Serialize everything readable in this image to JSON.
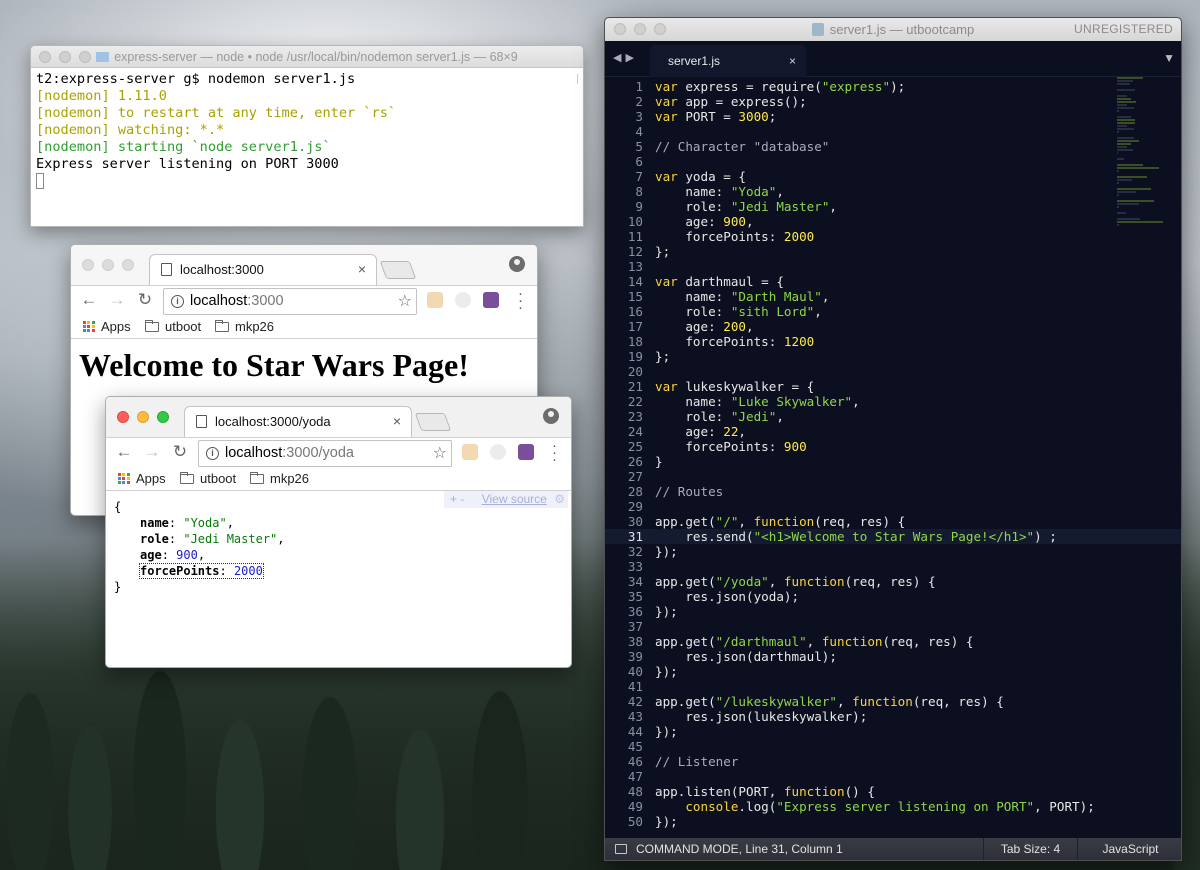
{
  "terminal": {
    "title": "express-server — node • node /usr/local/bin/nodemon server1.js — 68×9",
    "lines": [
      {
        "text": "t2:express-server g$ nodemon server1.js",
        "style": "plain"
      },
      {
        "text": "[nodemon] 1.11.0",
        "style": "yellow"
      },
      {
        "text": "[nodemon] to restart at any time, enter `rs`",
        "style": "yellow"
      },
      {
        "text": "[nodemon] watching: *.*",
        "style": "yellow"
      },
      {
        "text": "[nodemon] starting `node server1.js`",
        "style": "green"
      },
      {
        "text": "Express server listening on PORT 3000",
        "style": "plain"
      }
    ]
  },
  "browser_back": {
    "tab_title": "localhost:3000",
    "url_host": "localhost",
    "url_path": ":3000",
    "bookmarks": [
      "Apps",
      "utboot",
      "mkp26"
    ],
    "heading": "Welcome to Star Wars Page!"
  },
  "browser_front": {
    "tab_title": "localhost:3000/yoda",
    "url_host": "localhost",
    "url_path": ":3000/yoda",
    "bookmarks": [
      "Apps",
      "utboot",
      "mkp26"
    ],
    "view_source_controls": "+ -",
    "view_source": "View source",
    "json": {
      "open": "{",
      "close": "}",
      "entries": [
        {
          "key": "name",
          "value": "\"Yoda\"",
          "type": "string"
        },
        {
          "key": "role",
          "value": "\"Jedi Master\"",
          "type": "string"
        },
        {
          "key": "age",
          "value": "900",
          "type": "number"
        },
        {
          "key": "forcePoints",
          "value": "2000",
          "type": "number"
        }
      ]
    }
  },
  "editor": {
    "title": "server1.js — utbootcamp",
    "unregistered": "UNREGISTERED",
    "tab": "server1.js",
    "current_line": 31,
    "status": {
      "mode": "COMMAND MODE, Line 31, Column 1",
      "tab_size": "Tab Size: 4",
      "syntax": "JavaScript"
    },
    "code": [
      [
        [
          "kw",
          "var"
        ],
        [
          "p",
          " express = require("
        ],
        [
          "str",
          "\"express\""
        ],
        [
          "p",
          ");"
        ]
      ],
      [
        [
          "kw",
          "var"
        ],
        [
          "p",
          " app = express();"
        ]
      ],
      [
        [
          "kw",
          "var"
        ],
        [
          "p",
          " PORT = "
        ],
        [
          "num",
          "3000"
        ],
        [
          "p",
          ";"
        ]
      ],
      [],
      [
        [
          "com",
          "// Character \"database\""
        ]
      ],
      [],
      [
        [
          "kw",
          "var"
        ],
        [
          "p",
          " yoda = {"
        ]
      ],
      [
        [
          "p",
          "    name: "
        ],
        [
          "str",
          "\"Yoda\""
        ],
        [
          "p",
          ","
        ]
      ],
      [
        [
          "p",
          "    role: "
        ],
        [
          "str",
          "\"Jedi Master\""
        ],
        [
          "p",
          ","
        ]
      ],
      [
        [
          "p",
          "    age: "
        ],
        [
          "num",
          "900"
        ],
        [
          "p",
          ","
        ]
      ],
      [
        [
          "p",
          "    forcePoints: "
        ],
        [
          "num",
          "2000"
        ]
      ],
      [
        [
          "p",
          "};"
        ]
      ],
      [],
      [
        [
          "kw",
          "var"
        ],
        [
          "p",
          " darthmaul = {"
        ]
      ],
      [
        [
          "p",
          "    name: "
        ],
        [
          "str",
          "\"Darth Maul\""
        ],
        [
          "p",
          ","
        ]
      ],
      [
        [
          "p",
          "    role: "
        ],
        [
          "str",
          "\"sith Lord\""
        ],
        [
          "p",
          ","
        ]
      ],
      [
        [
          "p",
          "    age: "
        ],
        [
          "num",
          "200"
        ],
        [
          "p",
          ","
        ]
      ],
      [
        [
          "p",
          "    forcePoints: "
        ],
        [
          "num",
          "1200"
        ]
      ],
      [
        [
          "p",
          "};"
        ]
      ],
      [],
      [
        [
          "kw",
          "var"
        ],
        [
          "p",
          " lukeskywalker = {"
        ]
      ],
      [
        [
          "p",
          "    name: "
        ],
        [
          "str",
          "\"Luke Skywalker\""
        ],
        [
          "p",
          ","
        ]
      ],
      [
        [
          "p",
          "    role: "
        ],
        [
          "str",
          "\"Jedi\""
        ],
        [
          "p",
          ","
        ]
      ],
      [
        [
          "p",
          "    age: "
        ],
        [
          "num",
          "22"
        ],
        [
          "p",
          ","
        ]
      ],
      [
        [
          "p",
          "    forcePoints: "
        ],
        [
          "num",
          "900"
        ]
      ],
      [
        [
          "p",
          "}"
        ]
      ],
      [],
      [
        [
          "com",
          "// Routes"
        ]
      ],
      [],
      [
        [
          "p",
          "app.get("
        ],
        [
          "str",
          "\"/\""
        ],
        [
          "p",
          ", "
        ],
        [
          "kw",
          "function"
        ],
        [
          "p",
          "(req, res) {"
        ]
      ],
      [
        [
          "p",
          "    res.send("
        ],
        [
          "str",
          "\"<h1>Welcome to Star Wars Page!</h1>\""
        ],
        [
          "p",
          ") ;"
        ]
      ],
      [
        [
          "p",
          "});"
        ]
      ],
      [],
      [
        [
          "p",
          "app.get("
        ],
        [
          "str",
          "\"/yoda\""
        ],
        [
          "p",
          ", "
        ],
        [
          "kw",
          "function"
        ],
        [
          "p",
          "(req, res) {"
        ]
      ],
      [
        [
          "p",
          "    res.json(yoda);"
        ]
      ],
      [
        [
          "p",
          "});"
        ]
      ],
      [],
      [
        [
          "p",
          "app.get("
        ],
        [
          "str",
          "\"/darthmaul\""
        ],
        [
          "p",
          ", "
        ],
        [
          "kw",
          "function"
        ],
        [
          "p",
          "(req, res) {"
        ]
      ],
      [
        [
          "p",
          "    res.json(darthmaul);"
        ]
      ],
      [
        [
          "p",
          "});"
        ]
      ],
      [],
      [
        [
          "p",
          "app.get("
        ],
        [
          "str",
          "\"/lukeskywalker\""
        ],
        [
          "p",
          ", "
        ],
        [
          "kw",
          "function"
        ],
        [
          "p",
          "(req, res) {"
        ]
      ],
      [
        [
          "p",
          "    res.json(lukeskywalker);"
        ]
      ],
      [
        [
          "p",
          "});"
        ]
      ],
      [],
      [
        [
          "com",
          "// Listener"
        ]
      ],
      [],
      [
        [
          "p",
          "app.listen(PORT, "
        ],
        [
          "kw",
          "function"
        ],
        [
          "p",
          "() {"
        ]
      ],
      [
        [
          "p",
          "    "
        ],
        [
          "kw",
          "console"
        ],
        [
          "p",
          ".log("
        ],
        [
          "str",
          "\"Express server listening on PORT\""
        ],
        [
          "p",
          ", PORT);"
        ]
      ],
      [
        [
          "p",
          "});"
        ]
      ]
    ]
  }
}
